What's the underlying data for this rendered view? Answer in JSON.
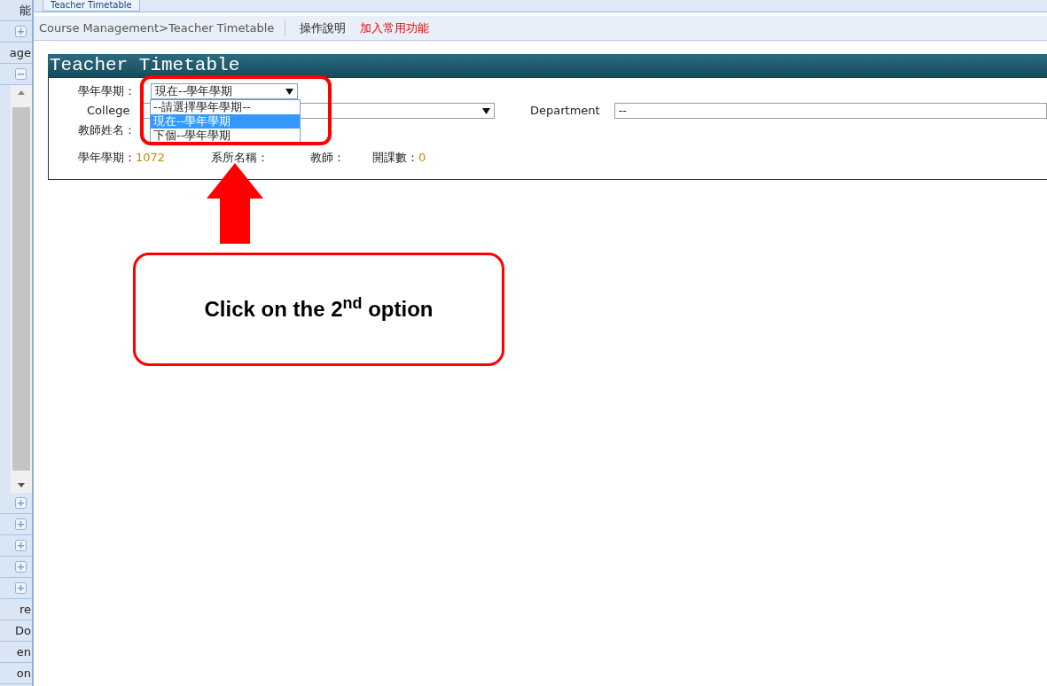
{
  "top_tab": {
    "label": "Teacher Timetable"
  },
  "sidebar": {
    "items": [
      {
        "kind": "text",
        "label": "能"
      },
      {
        "kind": "expand"
      },
      {
        "kind": "text",
        "label": "age"
      },
      {
        "kind": "collapse"
      },
      {
        "kind": "scrollbar"
      },
      {
        "kind": "expand"
      },
      {
        "kind": "expand"
      },
      {
        "kind": "expand"
      },
      {
        "kind": "expand"
      },
      {
        "kind": "expand"
      },
      {
        "kind": "text",
        "label": "re"
      },
      {
        "kind": "text",
        "label": "Do"
      },
      {
        "kind": "text",
        "label": "en"
      },
      {
        "kind": "text",
        "label": "on"
      }
    ]
  },
  "breadcrumb": {
    "path": "Course Management>Teacher Timetable",
    "help_link": "操作說明",
    "favorite_link": "加入常用功能"
  },
  "panel": {
    "title": "Teacher Timetable",
    "term": {
      "label": "學年學期：",
      "value": "現在--學年學期",
      "expanded": true,
      "options": [
        {
          "label": "--請選擇學年學期--",
          "selected": false
        },
        {
          "label": "現在--學年學期",
          "selected": true
        },
        {
          "label": "下個--學年學期",
          "selected": false
        }
      ]
    },
    "college": {
      "label": "College"
    },
    "department": {
      "label": "Department",
      "value": "--"
    },
    "teacher_name": {
      "label": "教師姓名："
    },
    "summary": [
      {
        "label": "學年學期：",
        "value": "1072"
      },
      {
        "label": "系所名稱："
      },
      {
        "label": "教師："
      },
      {
        "label": "開課數：",
        "value": "0"
      }
    ]
  },
  "annotation": {
    "callout": "Click on the 2$^{nd}$ option"
  }
}
